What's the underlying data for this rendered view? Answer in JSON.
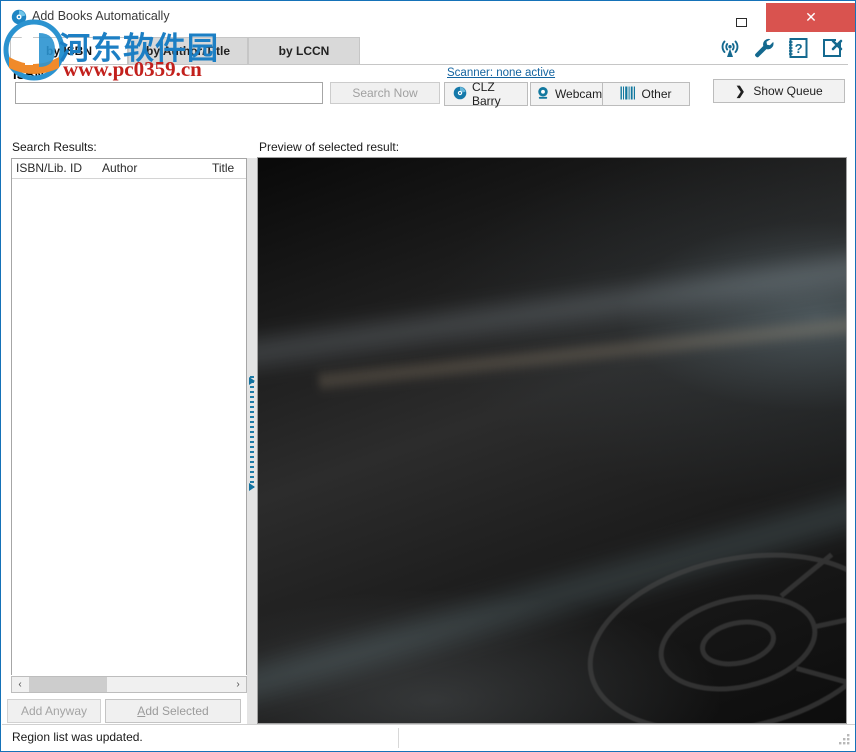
{
  "window": {
    "title": "Add Books Automatically",
    "app_icon": "clz-disc-icon",
    "controls": {
      "minimize": "minimize-icon",
      "maximize": "maximize-icon",
      "close": "✕"
    }
  },
  "toolbar_icons": [
    {
      "name": "wireless-scanner-icon",
      "label": "Wireless"
    },
    {
      "name": "wrench-settings-icon",
      "label": "Settings"
    },
    {
      "name": "help-book-icon",
      "label": "Help"
    },
    {
      "name": "close-box-icon",
      "label": "Close"
    }
  ],
  "tabs": [
    {
      "id": "isbn",
      "label": "by ISBN",
      "active": true
    },
    {
      "id": "author",
      "label": "by Author/Title",
      "active": false
    },
    {
      "id": "lccn",
      "label": "by LCCN",
      "active": false
    }
  ],
  "search": {
    "field_label": "ISBN",
    "input_value": "",
    "input_placeholder": "",
    "search_button": "Search Now",
    "search_button_enabled": false
  },
  "scanner": {
    "status_link": "Scanner: none active",
    "buttons": [
      {
        "name": "clz-barry-button",
        "label": "CLZ Barry",
        "icon": "clz-disc-icon"
      },
      {
        "name": "webcam-button",
        "label": "Webcam",
        "icon": "webcam-icon"
      },
      {
        "name": "other-scanner-button",
        "label": "Other",
        "icon": "barcode-icon"
      }
    ]
  },
  "queue": {
    "show_queue_label": "Show Queue",
    "chevron": "❯"
  },
  "results": {
    "section_label": "Search Results:",
    "columns": [
      "ISBN/Lib. ID",
      "Author",
      "Title"
    ],
    "rows": [],
    "scrollbar": {
      "left_arrow": "‹",
      "right_arrow": "›"
    }
  },
  "actions": {
    "add_anyway": "Add Anyway",
    "add_selected_prefix": "A",
    "add_selected_rest": "dd Selected",
    "add_anyway_enabled": false,
    "add_selected_enabled": false
  },
  "preview": {
    "section_label": "Preview of selected result:",
    "image": "dark-abstract-wallpaper"
  },
  "statusbar": {
    "message": "Region list was updated.",
    "resize_grip": "resize-grip-icon"
  },
  "watermark": {
    "chinese": "河东软件园",
    "url": "www.pc0359.cn",
    "logo": "pc0359-logo-icon"
  },
  "colors": {
    "accent_blue": "#1572b8",
    "close_red": "#d9534f",
    "link_blue": "#1464a0",
    "tab_inactive": "#d9d9d9",
    "watermark_blue": "#1c7fc4",
    "watermark_red": "#c2201c"
  }
}
